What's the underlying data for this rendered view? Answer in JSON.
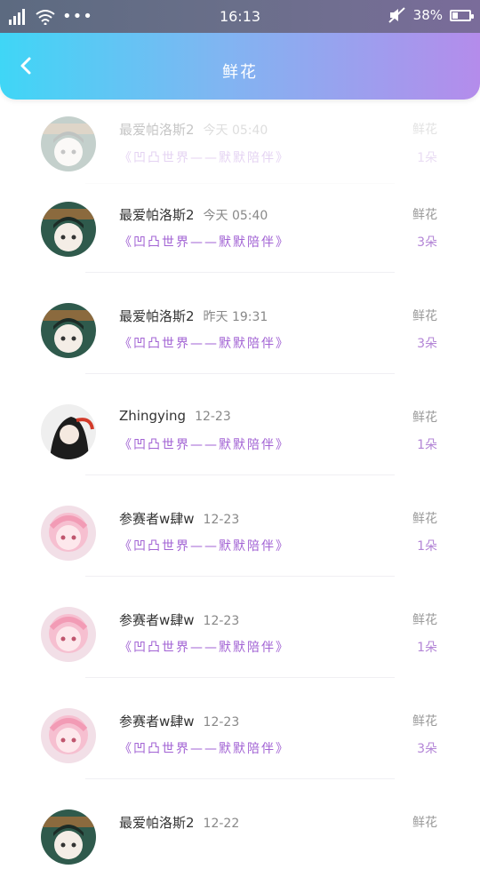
{
  "status_bar": {
    "time": "16:13",
    "battery": "38%"
  },
  "header": {
    "title": "鲜花"
  },
  "colors": {
    "gradient_start": "#3fd6f6",
    "gradient_end": "#b48ceb",
    "accent_purple": "#a263d4"
  },
  "rows": [
    {
      "name": "最爱帕洛斯2",
      "date": "今天 05:40",
      "gift": "鲜花",
      "work": "《凹凸世界——默默陪伴》",
      "count": "1朵",
      "avatar": "avatar-boy-icon"
    },
    {
      "name": "最爱帕洛斯2",
      "date": "今天 05:40",
      "gift": "鲜花",
      "work": "《凹凸世界——默默陪伴》",
      "count": "3朵",
      "avatar": "avatar-boy-icon"
    },
    {
      "name": "最爱帕洛斯2",
      "date": "昨天 19:31",
      "gift": "鲜花",
      "work": "《凹凸世界——默默陪伴》",
      "count": "3朵",
      "avatar": "avatar-boy-icon"
    },
    {
      "name": "Zhingying",
      "date": "12-23",
      "gift": "鲜花",
      "work": "《凹凸世界——默默陪伴》",
      "count": "1朵",
      "avatar": "avatar-dark-hair-icon"
    },
    {
      "name": "参赛者w肆w",
      "date": "12-23",
      "gift": "鲜花",
      "work": "《凹凸世界——默默陪伴》",
      "count": "1朵",
      "avatar": "avatar-pink-girl-icon"
    },
    {
      "name": "参赛者w肆w",
      "date": "12-23",
      "gift": "鲜花",
      "work": "《凹凸世界——默默陪伴》",
      "count": "1朵",
      "avatar": "avatar-pink-girl-icon"
    },
    {
      "name": "参赛者w肆w",
      "date": "12-23",
      "gift": "鲜花",
      "work": "《凹凸世界——默默陪伴》",
      "count": "3朵",
      "avatar": "avatar-pink-girl-icon"
    },
    {
      "name": "最爱帕洛斯2",
      "date": "12-22",
      "gift": "鲜花",
      "work": "",
      "count": "",
      "avatar": "avatar-boy-icon"
    }
  ]
}
